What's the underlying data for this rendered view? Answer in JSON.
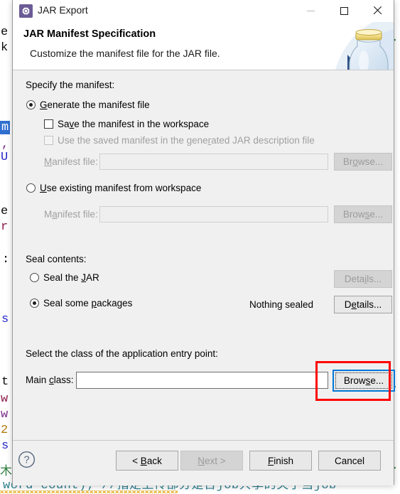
{
  "window": {
    "title": "JAR Export",
    "icon": "jar-export-gear-icon",
    "minimize_label": "—",
    "maximize_label": "□",
    "close_label": "×"
  },
  "header": {
    "title": "JAR Manifest Specification",
    "subtitle": "Customize the manifest file for the JAR file.",
    "art_icon": "jar-bottle-icon"
  },
  "manifest": {
    "section_label": "Specify the manifest:",
    "generate_radio": {
      "label": "Generate the manifest file",
      "mnemonic": "G",
      "checked": true,
      "enabled": true
    },
    "save_checkbox": {
      "label": "Save the manifest in the workspace",
      "mnemonic": "v",
      "checked": false,
      "enabled": true
    },
    "use_saved_checkbox": {
      "label": "Use the saved manifest in the generated JAR description file",
      "mnemonic": "r",
      "checked": false,
      "enabled": false
    },
    "generate_file_row": {
      "label": "Manifest file:",
      "mnemonic": "M",
      "value": "",
      "enabled": false,
      "browse_label": "Browse...",
      "browse_mnemonic": "o",
      "browse_enabled": false
    },
    "use_existing_radio": {
      "label": "Use existing manifest from workspace",
      "mnemonic": "U",
      "checked": false,
      "enabled": true
    },
    "existing_file_row": {
      "label": "Manifest file:",
      "mnemonic": "a",
      "value": "",
      "enabled": false,
      "browse_label": "Browse...",
      "browse_mnemonic": "s",
      "browse_enabled": false
    }
  },
  "seal": {
    "section_label": "Seal contents:",
    "seal_jar_radio": {
      "label": "Seal the JAR",
      "mnemonic": "J",
      "checked": false,
      "enabled": true
    },
    "seal_jar_details": {
      "label": "Details...",
      "mnemonic": "i",
      "enabled": false
    },
    "seal_packages_radio": {
      "label": "Seal some packages",
      "mnemonic": "p",
      "checked": true,
      "enabled": true
    },
    "seal_packages_status": "Nothing sealed",
    "seal_packages_details": {
      "label": "Details...",
      "mnemonic": "e",
      "enabled": true
    }
  },
  "entry_point": {
    "section_label": "Select the class of the application entry point:",
    "main_class_label": "Main class:",
    "main_class_mnemonic": "c",
    "main_class_value": "",
    "browse_label": "Browse...",
    "browse_mnemonic": "s",
    "browse_focused": true,
    "highlight_color": "#ff0000",
    "focus_color": "#0078d7"
  },
  "footer": {
    "help_icon": "help-question-icon",
    "back_label": "< Back",
    "back_mnemonic": "B",
    "back_enabled": true,
    "next_label": "Next >",
    "next_mnemonic": "N",
    "next_enabled": false,
    "finish_label": "Finish",
    "finish_mnemonic": "F",
    "finish_enabled": true,
    "cancel_label": "Cancel",
    "cancel_enabled": true
  },
  "background": {
    "left_chars": [
      "m",
      ",",
      "U",
      "e",
      "r",
      ":",
      "s",
      "t",
      "w",
      "w",
      "2",
      "s",
      "索"
    ],
    "bottom_text": "word count); //指定上传部分是否job共享的关于当job"
  }
}
